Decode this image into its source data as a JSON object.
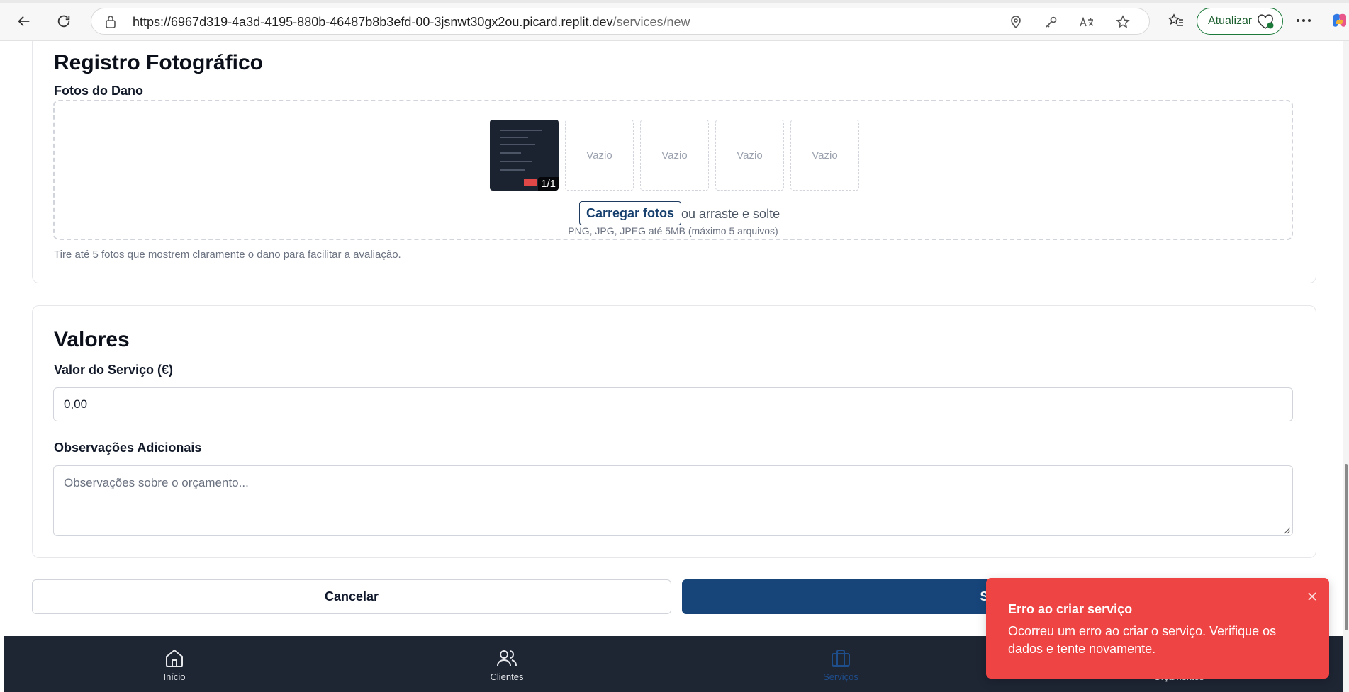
{
  "browser": {
    "url_host": "https://6967d319-4a3d-4195-880b-46487b8b3efd-00-3jsnwt30gx2ou.picard.replit.dev",
    "url_path": "/services/new",
    "update_label": "Atualizar"
  },
  "photos": {
    "title": "Registro Fotográfico",
    "label": "Fotos do Dano",
    "filled_counter": "1/1",
    "empty_slot_label": "Vazio",
    "empty_slots": [
      "Vazio",
      "Vazio",
      "Vazio",
      "Vazio"
    ],
    "upload_button": "Carregar fotos",
    "drop_text": "ou arraste e solte",
    "drop_hint": "PNG, JPG, JPEG até 5MB (máximo 5 arquivos)",
    "helper": "Tire até 5 fotos que mostrem claramente o dano para facilitar a avaliação."
  },
  "values": {
    "title": "Valores",
    "price_label": "Valor do Serviço (€)",
    "price_value": "0,00",
    "notes_label": "Observações Adicionais",
    "notes_placeholder": "Observações sobre o orçamento..."
  },
  "actions": {
    "cancel": "Cancelar",
    "save": "Salvar"
  },
  "bottom_nav": [
    {
      "label": "Início",
      "icon": "home-icon"
    },
    {
      "label": "Clientes",
      "icon": "users-icon"
    },
    {
      "label": "Serviços",
      "icon": "briefcase-icon",
      "active": true
    },
    {
      "label": "Orçamentos",
      "icon": "file-icon"
    }
  ],
  "toast": {
    "title": "Erro ao criar serviço",
    "description": "Ocorreu um erro ao criar o serviço. Verifique os dados e tente novamente."
  },
  "colors": {
    "primary": "#17457a",
    "nav_bg": "#1e2533",
    "toast_bg": "#ef4444"
  }
}
